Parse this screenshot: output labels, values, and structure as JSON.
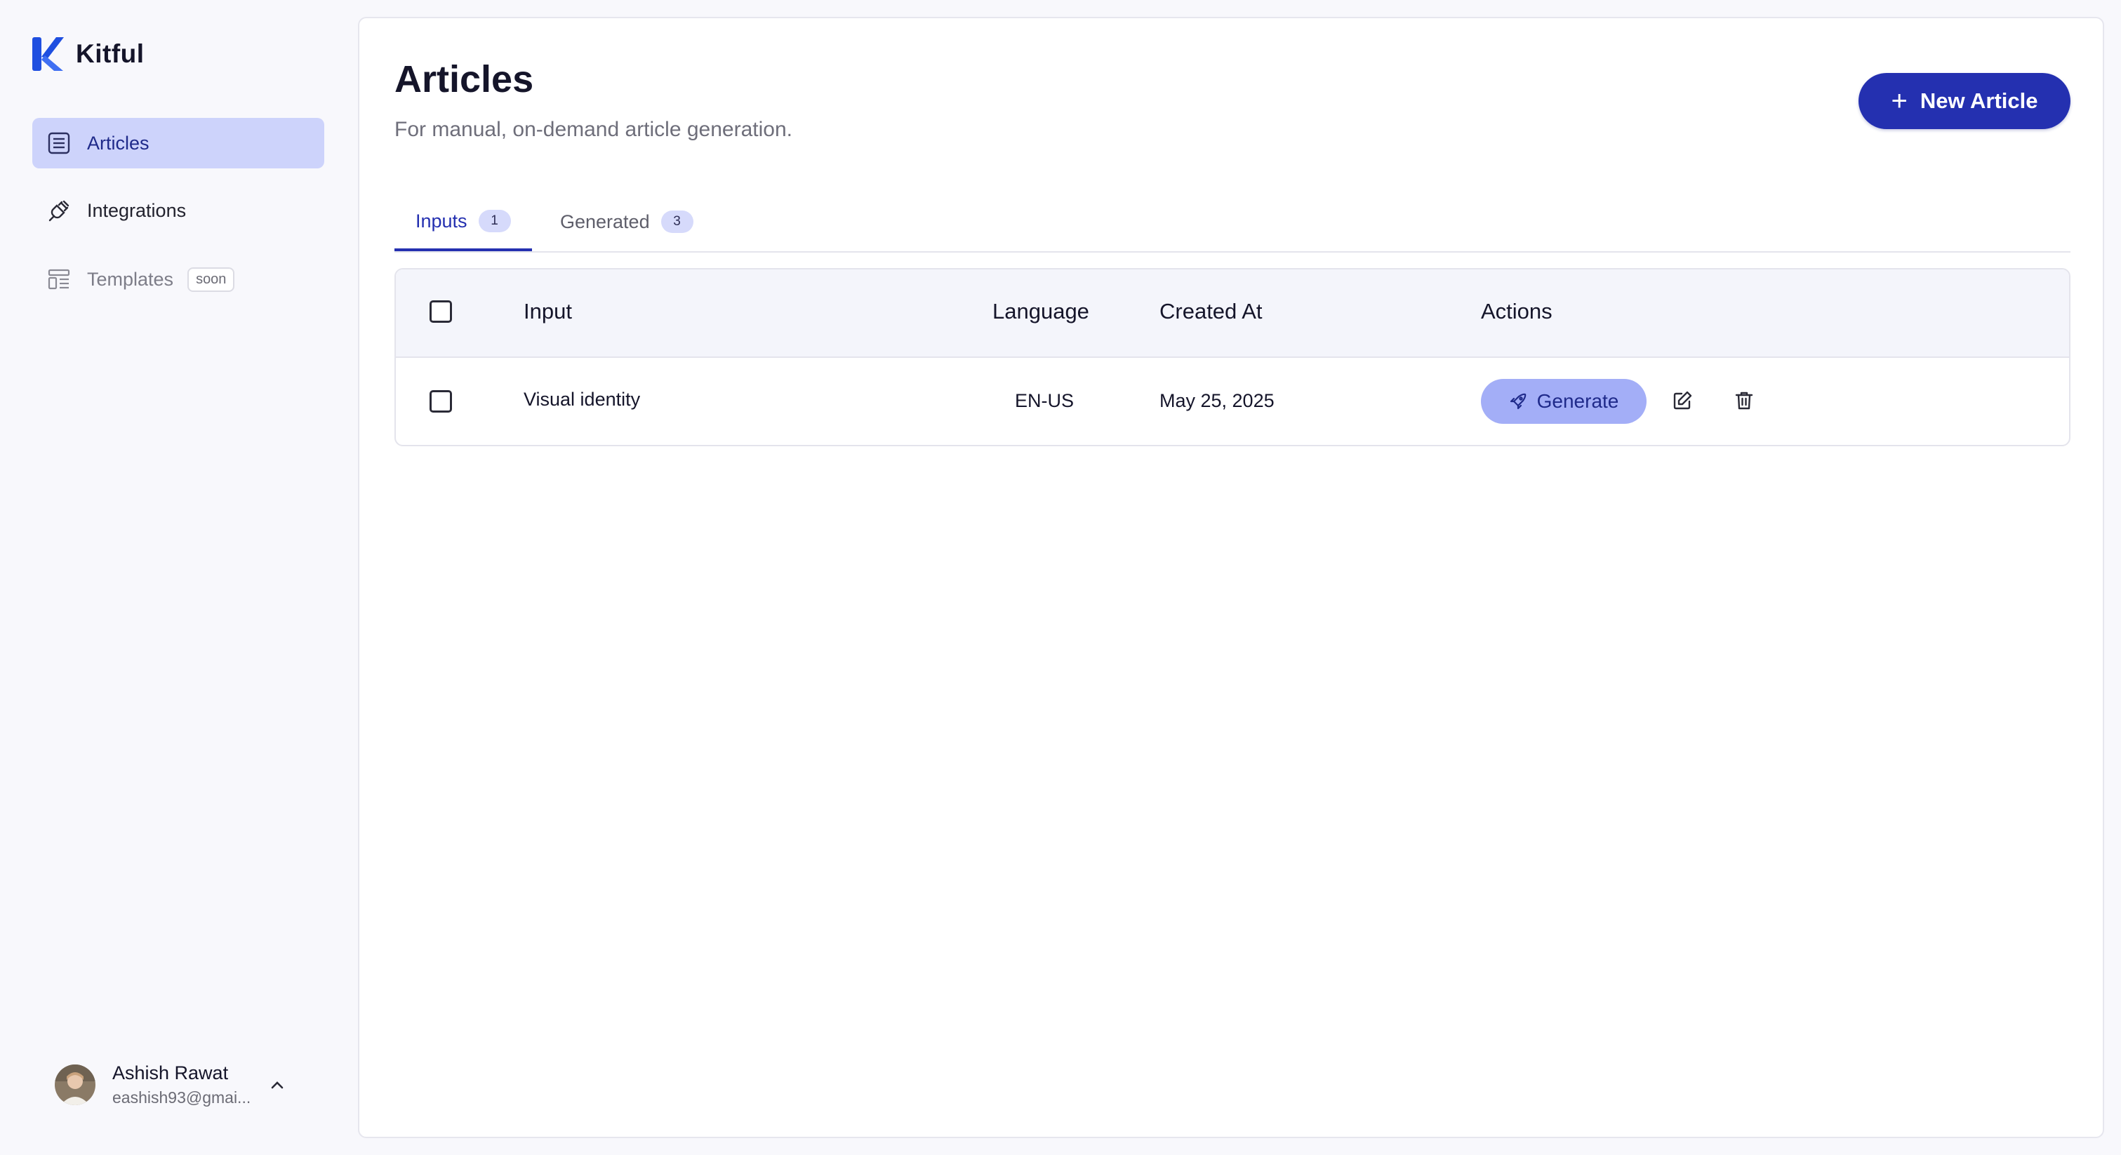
{
  "brand": {
    "name": "Kitful",
    "accent": "#1f4fe0"
  },
  "sidebar": {
    "items": [
      {
        "label": "Articles",
        "icon": "list-icon",
        "active": true
      },
      {
        "label": "Integrations",
        "icon": "plug-icon",
        "active": false
      },
      {
        "label": "Templates",
        "icon": "layout-icon",
        "active": false,
        "badge": "soon"
      }
    ]
  },
  "user": {
    "name": "Ashish Rawat",
    "email": "eashish93@gmai..."
  },
  "page": {
    "title": "Articles",
    "subtitle": "For manual, on-demand article generation.",
    "new_button": "New Article"
  },
  "tabs": [
    {
      "label": "Inputs",
      "count": "1",
      "active": true
    },
    {
      "label": "Generated",
      "count": "3",
      "active": false
    }
  ],
  "table": {
    "columns": [
      "Input",
      "Language",
      "Created At",
      "Actions"
    ],
    "rows": [
      {
        "input": "Visual identity",
        "language": "EN-US",
        "created_at": "May 25, 2025",
        "action_label": "Generate"
      }
    ]
  },
  "colors": {
    "primary": "#2430b0",
    "active_nav": "#cdd3fb",
    "generate": "#a3aef7"
  }
}
